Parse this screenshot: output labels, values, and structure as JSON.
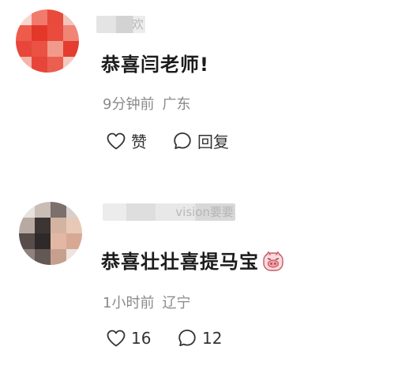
{
  "comments": [
    {
      "username": "欢",
      "text": "恭喜闫老师!",
      "time": "9分钟前",
      "region": "广东",
      "like_label": "赞",
      "reply_label": "回复"
    },
    {
      "username": "vision要要",
      "text": "恭喜壮壮喜提马宝",
      "time": "1小时前",
      "region": "辽宁",
      "like_label": "16",
      "reply_label": "12"
    }
  ]
}
